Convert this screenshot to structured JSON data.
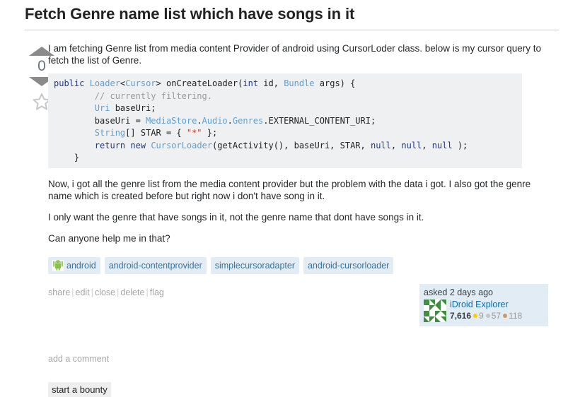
{
  "question": {
    "title": "Fetch Genre name list which have songs in it",
    "vote_count": "0",
    "vote_up_icon": "arrow-up-icon",
    "vote_down_icon": "arrow-down-icon",
    "favorite_icon": "star-outline-icon",
    "paragraphs": {
      "intro": "I am fetching Genre list from media content Provider of android using CursorLoder class. below is my cursor query to fetch the list of Genre.",
      "after_code_1": "Now, i got all the genre list from the media content provider but the problem with the data i got. I also got the genre name which is created before but right now i don't have song in it.",
      "after_code_2": "I only want the genre that have songs in it, not the genre name that dont have songs in it.",
      "after_code_3": "Can anyone help me in that?"
    },
    "code": {
      "language": "java",
      "lines": [
        "public Loader<Cursor> onCreateLoader(int id, Bundle args) {",
        "        // currently filtering.",
        "        Uri baseUri;",
        "        baseUri = MediaStore.Audio.Genres.EXTERNAL_CONTENT_URI;",
        "        String[] STAR = { \"*\" };",
        "        return new CursorLoader(getActivity(), baseUri, STAR, null, null, null );",
        "    }"
      ],
      "background": "#eff0f1",
      "keyword_color": "#1e3a8a",
      "type_color": "#5f9fd0",
      "comment_color": "#9a9a9a",
      "string_color": "#c0392b"
    },
    "tags": [
      {
        "label": "android",
        "icon": "android-robot-icon"
      },
      {
        "label": "android-contentprovider",
        "icon": null
      },
      {
        "label": "simplecursoradapter",
        "icon": null
      },
      {
        "label": "android-cursorloader",
        "icon": null
      }
    ],
    "tag_background": "#e1ecf4",
    "tag_color": "#39739d",
    "actions": [
      "share",
      "edit",
      "close",
      "delete",
      "flag"
    ],
    "action_separator": "|",
    "user_card": {
      "action_time": "asked 2 days ago",
      "avatar_icon": "identicon-avatar",
      "display_name": "iDroid Explorer",
      "reputation": "7,616",
      "badges": {
        "gold": "9",
        "silver": "57",
        "bronze": "118"
      },
      "gold_color": "#ffcc01",
      "silver_color": "#c5c5c5",
      "bronze_color": "#cc9a66",
      "background": "#e1ecf4"
    },
    "add_comment_label": "add a comment",
    "start_bounty_label": "start a bounty"
  }
}
